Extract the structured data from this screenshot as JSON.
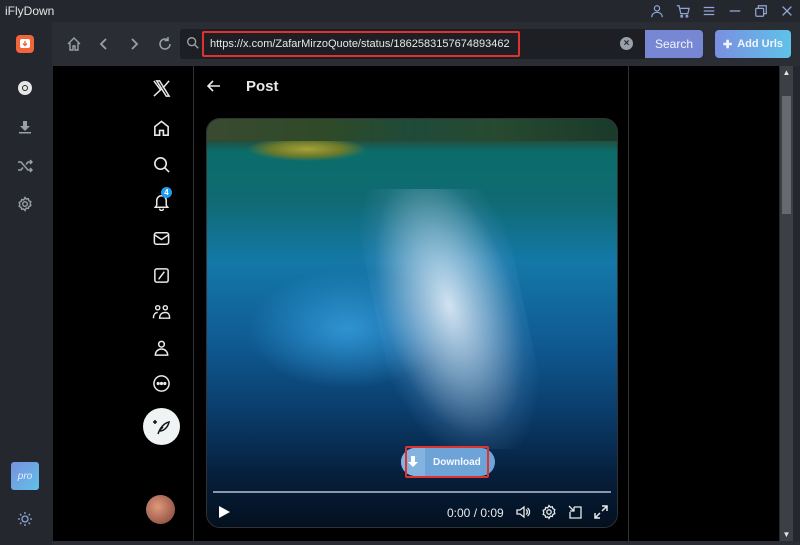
{
  "app": {
    "title": "iFlyDown",
    "brand_color": "#f0653a",
    "accent_color": "#7787d4"
  },
  "window_controls": [
    {
      "name": "account-icon",
      "label": "Account"
    },
    {
      "name": "cart-icon",
      "label": "Store"
    },
    {
      "name": "menu-icon",
      "label": "Menu"
    },
    {
      "name": "minimize-icon",
      "label": "Minimize"
    },
    {
      "name": "restore-icon",
      "label": "Restore"
    },
    {
      "name": "close-icon",
      "label": "Close"
    }
  ],
  "sidebar": {
    "items": [
      {
        "name": "browser-icon",
        "label": "Browser"
      },
      {
        "name": "downloads-icon",
        "label": "Downloads"
      },
      {
        "name": "convert-icon",
        "label": "Convert"
      },
      {
        "name": "settings-icon",
        "label": "Settings"
      }
    ],
    "pro_label": "pro",
    "theme_toggle": "theme-icon"
  },
  "toolbar": {
    "url": "https://x.com/ZafarMirzoQuote/status/1862583157674893462",
    "search_label": "Search",
    "add_urls_label": "Add Urls"
  },
  "x_nav": {
    "notification_count": "4",
    "items": [
      "home",
      "explore",
      "notifications",
      "messages",
      "grok",
      "communities",
      "profile",
      "more"
    ]
  },
  "post": {
    "header_title": "Post",
    "video": {
      "current_time": "0:00",
      "duration": "0:09",
      "time_display": "0:00 / 0:09",
      "progress": 0
    },
    "download_label": "Download"
  }
}
